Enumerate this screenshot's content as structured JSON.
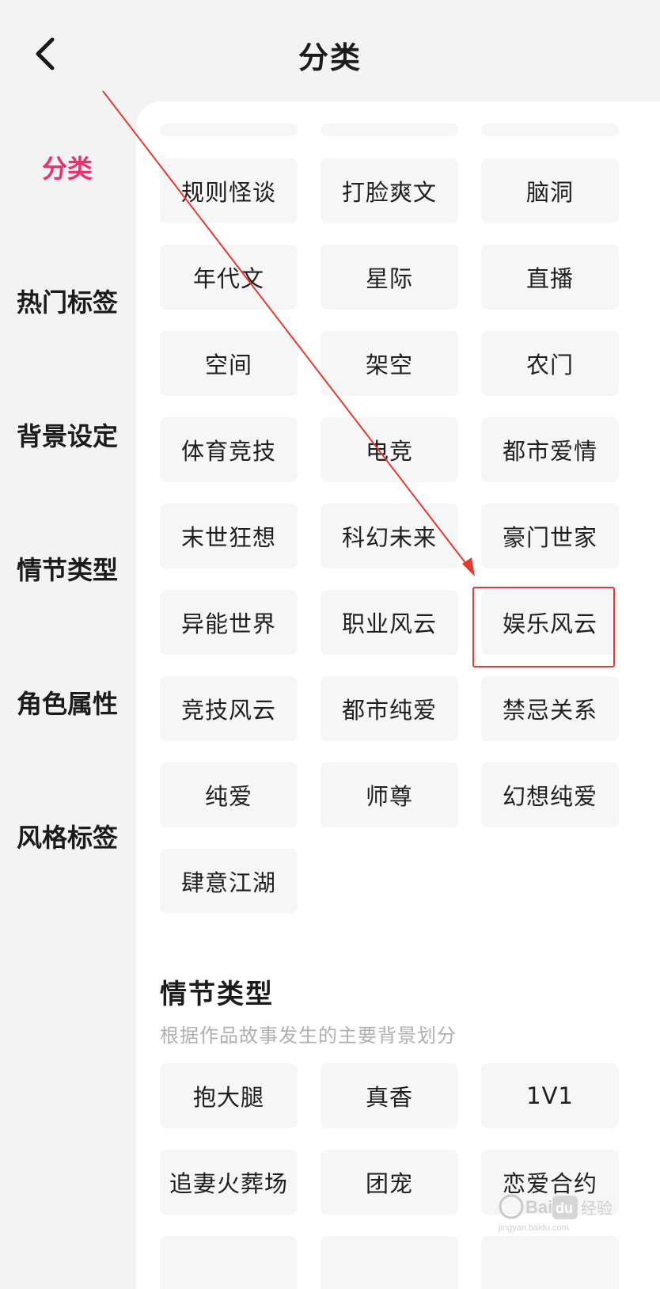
{
  "header": {
    "title": "分类"
  },
  "sidebar": {
    "items": [
      {
        "label": "分类",
        "active": true
      },
      {
        "label": "热门标签",
        "active": false
      },
      {
        "label": "背景设定",
        "active": false
      },
      {
        "label": "情节类型",
        "active": false
      },
      {
        "label": "角色属性",
        "active": false
      },
      {
        "label": "风格标签",
        "active": false
      }
    ]
  },
  "categories": {
    "chips": [
      "规则怪谈",
      "打脸爽文",
      "脑洞",
      "年代文",
      "星际",
      "直播",
      "空间",
      "架空",
      "农门",
      "体育竞技",
      "电竞",
      "都市爱情",
      "末世狂想",
      "科幻未来",
      "豪门世家",
      "异能世界",
      "职业风云",
      "娱乐风云",
      "竞技风云",
      "都市纯爱",
      "禁忌关系",
      "纯爱",
      "师尊",
      "幻想纯爱",
      "肆意江湖"
    ],
    "highlighted": "娱乐风云"
  },
  "plot_section": {
    "title": "情节类型",
    "description": "根据作品故事发生的主要背景划分",
    "chips": [
      "抱大腿",
      "真香",
      "1V1",
      "追妻火葬场",
      "团宠",
      "恋爱合约"
    ]
  },
  "colors": {
    "accent": "#e8336d",
    "annotation": "#e53a30",
    "chip_bg": "#f6f6f7",
    "sidebar_bg": "#f3f3f3"
  },
  "watermark": {
    "brand": "Baidu经验",
    "url": "jingyan.baidu.com"
  }
}
